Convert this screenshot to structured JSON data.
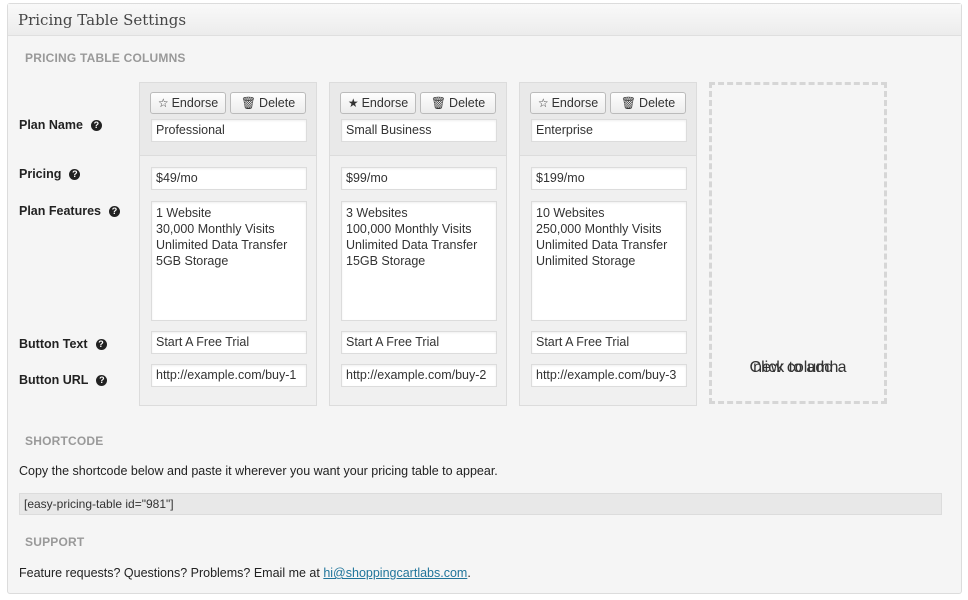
{
  "panel": {
    "title": "Pricing Table Settings"
  },
  "sections": {
    "columns_title": "PRICING TABLE COLUMNS",
    "shortcode_title": "SHORTCODE",
    "support_title": "SUPPORT"
  },
  "row_labels": {
    "plan_name": "Plan Name",
    "pricing": "Pricing",
    "plan_features": "Plan Features",
    "button_text": "Button Text",
    "button_url": "Button URL"
  },
  "buttons": {
    "endorse": "Endorse",
    "delete": "Delete"
  },
  "columns": [
    {
      "endorsed": false,
      "plan_name": "Professional",
      "pricing": "$49/mo",
      "features": [
        "1 Website",
        "30,000 Monthly Visits",
        "Unlimited Data Transfer",
        "5GB Storage"
      ],
      "button_text": "Start A Free Trial",
      "button_url": "http://example.com/buy-1"
    },
    {
      "endorsed": true,
      "plan_name": "Small Business",
      "pricing": "$99/mo",
      "features": [
        "3 Websites",
        "100,000 Monthly Visits",
        "Unlimited Data Transfer",
        "15GB Storage"
      ],
      "button_text": "Start A Free Trial",
      "button_url": "http://example.com/buy-2"
    },
    {
      "endorsed": false,
      "plan_name": "Enterprise",
      "pricing": "$199/mo",
      "features": [
        "10 Websites",
        "250,000 Monthly Visits",
        "Unlimited Data Transfer",
        "Unlimited Storage"
      ],
      "button_text": "Start A Free Trial",
      "button_url": "http://example.com/buy-3"
    }
  ],
  "add_column": {
    "line1": "Click to add a",
    "line2": "new column."
  },
  "shortcode": {
    "instructions": "Copy the shortcode below and paste it wherever you want your pricing table to appear.",
    "code": "[easy-pricing-table id=\"981\"]"
  },
  "support": {
    "text": "Feature requests? Questions? Problems? Email me at",
    "email": "hi@shoppingcartlabs.com",
    "suffix": "."
  },
  "icons": {
    "star_empty": "star-outline-icon",
    "star_filled": "star-filled-icon",
    "trash": "trash-icon",
    "help": "question-circle-icon"
  }
}
